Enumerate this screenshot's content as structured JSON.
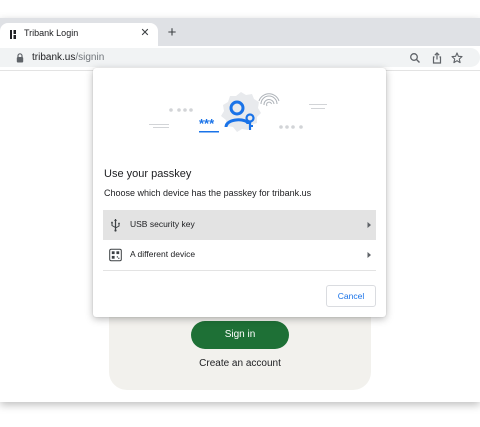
{
  "browser": {
    "tab_title": "Tribank Login",
    "close_glyph": "✕",
    "new_tab_glyph": "+",
    "url_host": "tribank.us",
    "url_path": "/signin",
    "icons": [
      "lock-icon",
      "search-icon",
      "share-icon",
      "bookmark-star-icon"
    ]
  },
  "page": {
    "signin_label": "Sign in",
    "create_account_label": "Create an account",
    "signin_color": "#1e7036"
  },
  "dialog": {
    "illustration_text": "***",
    "title": "Use your passkey",
    "subtitle": "Choose which device has the passkey for tribank.us",
    "options": [
      {
        "label": "USB security key",
        "icon": "usb-icon",
        "highlighted": true
      },
      {
        "label": "A different device",
        "icon": "qr-code-icon",
        "highlighted": false
      }
    ],
    "cancel_label": "Cancel",
    "accent_color": "#1a73e8"
  }
}
